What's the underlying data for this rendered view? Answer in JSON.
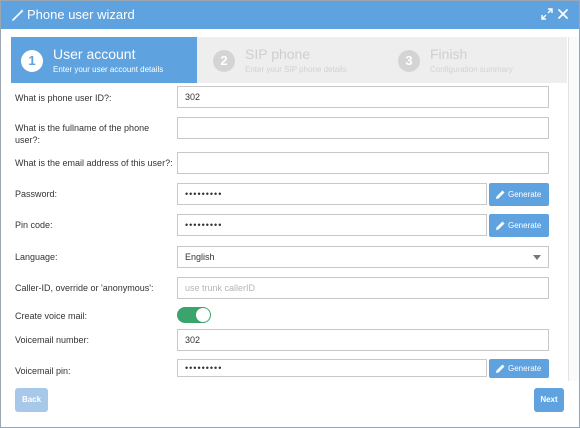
{
  "window": {
    "title": "Phone user wizard",
    "accent_color": "#5ea2df",
    "icons": {
      "title": "magic-wand-icon",
      "expand": "expand-icon",
      "close": "close-icon"
    }
  },
  "steps": [
    {
      "number": "1",
      "title": "User account",
      "subtitle": "Enter your user account details",
      "active": true
    },
    {
      "number": "2",
      "title": "SIP phone",
      "subtitle": "Enter your SIP phone details",
      "active": false
    },
    {
      "number": "3",
      "title": "Finish",
      "subtitle": "Configuration summary",
      "active": false
    }
  ],
  "form": {
    "user_id": {
      "label": "What is phone user ID?:",
      "value": "302"
    },
    "fullname": {
      "label": "What is the fullname of the phone user?:",
      "value": ""
    },
    "email": {
      "label": "What is the email address of this user?:",
      "value": ""
    },
    "password": {
      "label": "Password:",
      "value": "•••••••••"
    },
    "pin_code": {
      "label": "Pin code:",
      "value": "•••••••••"
    },
    "language": {
      "label": "Language:",
      "value": "English"
    },
    "caller_id": {
      "label": "Caller-ID, override or 'anonymous':",
      "value": "",
      "placeholder": "use trunk callerID"
    },
    "voicemail": {
      "label": "Create voice mail:",
      "enabled": true,
      "toggle_color": "#3aa46c"
    },
    "voicemail_number": {
      "label": "Voicemail number:",
      "value": "302"
    },
    "voicemail_pin": {
      "label": "Voicemail pin:",
      "value": "•••••••••"
    }
  },
  "generate_label": "Generate",
  "generate_icon": "pencil-icon",
  "footer": {
    "back_label": "Back",
    "next_label": "Next"
  }
}
